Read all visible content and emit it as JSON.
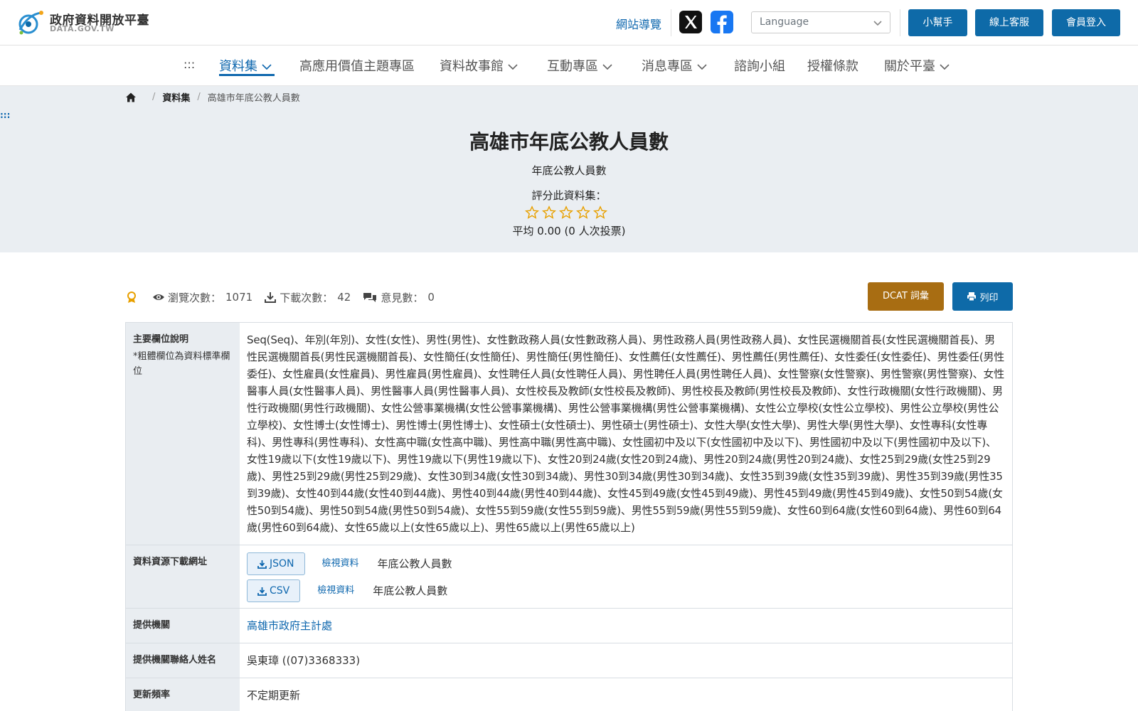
{
  "header": {
    "logo_title": "政府資料開放平臺",
    "logo_sub": "DATA.GOV.TW",
    "sitemap": "網站導覽",
    "language_placeholder": "Language",
    "help_btn": "小幫手",
    "service_btn": "線上客服",
    "login_btn": "會員登入",
    "colors": {
      "primary": "#0e6aa8",
      "link": "#0e67ae"
    }
  },
  "nav": {
    "accesskey": ":::",
    "items": [
      {
        "label": "資料集",
        "dropdown": true,
        "active": true
      },
      {
        "label": "高應用價值主題專區",
        "dropdown": false
      },
      {
        "label": "資料故事館",
        "dropdown": true
      },
      {
        "label": "互動專區",
        "dropdown": true
      },
      {
        "label": "消息專區",
        "dropdown": true
      },
      {
        "label": "諮詢小組",
        "dropdown": false
      },
      {
        "label": "授權條款",
        "dropdown": false
      },
      {
        "label": "關於平臺",
        "dropdown": true
      }
    ]
  },
  "breadcrumb": {
    "items": [
      "資料集",
      "高雄市年底公教人員數"
    ]
  },
  "side_accesskey": ":::",
  "dataset": {
    "title": "高雄市年底公教人員數",
    "description": "年底公教人員數",
    "rate_label": "評分此資料集：",
    "rating_stars": 0,
    "rating_max": 5,
    "rating_avg": "平均 0.00 (0 人次投票)"
  },
  "stats": {
    "views_label": "瀏覽次數：",
    "views": "1071",
    "downloads_label": "下載次數：",
    "downloads": "42",
    "comments_label": "意見數：",
    "comments": "0"
  },
  "actions": {
    "dcat": "DCAT 詞彙",
    "print": "列印",
    "dcat_color": "#a86d12"
  },
  "table": {
    "fields_label": "主要欄位說明",
    "fields_note": "*粗體欄位為資料標準欄位",
    "fields_text": "Seq(Seq)、年別(年別)、女性(女性)、男性(男性)、女性數政務人員(女性數政務人員)、男性政務人員(男性政務人員)、女性民選機關首長(女性民選機關首長)、男性民選機關首長(男性民選機關首長)、女性簡任(女性簡任)、男性簡任(男性簡任)、女性薦任(女性薦任)、男性薦任(男性薦任)、女性委任(女性委任)、男性委任(男性委任)、女性雇員(女性雇員)、男性雇員(男性雇員)、女性聘任人員(女性聘任人員)、男性聘任人員(男性聘任人員)、女性警察(女性警察)、男性警察(男性警察)、女性醫事人員(女性醫事人員)、男性醫事人員(男性醫事人員)、女性校長及教師(女性校長及教師)、男性校長及教師(男性校長及教師)、女性行政機關(女性行政機關)、男性行政機關(男性行政機關)、女性公營事業機構(女性公營事業機構)、男性公營事業機構(男性公營事業機構)、女性公立學校(女性公立學校)、男性公立學校(男性公立學校)、女性博士(女性博士)、男性博士(男性博士)、女性碩士(女性碩士)、男性碩士(男性碩士)、女性大學(女性大學)、男性大學(男性大學)、女性專科(女性專科)、男性專科(男性專科)、女性高中職(女性高中職)、男性高中職(男性高中職)、女性國初中及以下(女性國初中及以下)、男性國初中及以下(男性國初中及以下)、女性19歲以下(女性19歲以下)、男性19歲以下(男性19歲以下)、女性20到24歲(女性20到24歲)、男性20到24歲(男性20到24歲)、女性25到29歲(女性25到29歲)、男性25到29歲(男性25到29歲)、女性30到34歲(女性30到34歲)、男性30到34歲(男性30到34歲)、女性35到39歲(女性35到39歲)、男性35到39歲(男性35到39歲)、女性40到44歲(女性40到44歲)、男性40到44歲(男性40到44歲)、女性45到49歲(女性45到49歲)、男性45到49歲(男性45到49歲)、女性50到54歲(女性50到54歲)、男性50到54歲(男性50到54歲)、女性55到59歲(女性55到59歲)、男性55到59歲(男性55到59歲)、女性60到64歲(女性60到64歲)、男性60到64歲(男性60到64歲)、女性65歲以上(女性65歲以上)、男性65歲以上(男性65歲以上)",
    "resources_label": "資料資源下載網址",
    "resources": [
      {
        "format": "JSON",
        "view": "檢視資料",
        "desc": "年底公教人員數"
      },
      {
        "format": "CSV",
        "view": "檢視資料",
        "desc": "年底公教人員數"
      }
    ],
    "agency_label": "提供機關",
    "agency": "高雄市政府主計處",
    "contact_label": "提供機關聯絡人姓名",
    "contact": "吳東璋 ((07)3368333)",
    "frequency_label": "更新頻率",
    "frequency": "不定期更新"
  }
}
